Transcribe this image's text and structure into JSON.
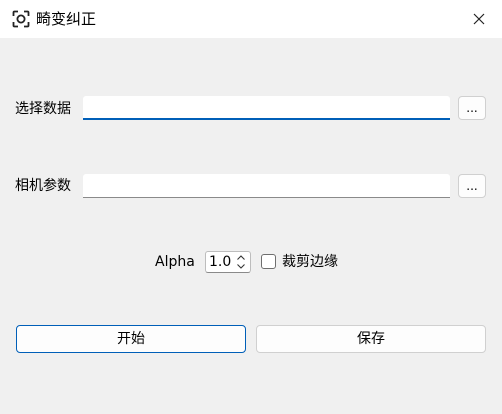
{
  "window": {
    "title": "畸变纠正",
    "icon": "camera-capture-icon",
    "close_icon": "close-icon"
  },
  "data_row": {
    "label": "选择数据",
    "value": "",
    "browse_label": "..."
  },
  "camera_row": {
    "label": "相机参数",
    "value": "",
    "browse_label": "..."
  },
  "options": {
    "alpha_label": "Alpha",
    "alpha_value": "1.0",
    "crop_label": "裁剪边缘",
    "crop_checked": false
  },
  "actions": {
    "start_label": "开始",
    "save_label": "保存"
  },
  "colors": {
    "accent": "#005fb8",
    "background": "#f0f0f0",
    "titlebar": "#ffffff"
  }
}
